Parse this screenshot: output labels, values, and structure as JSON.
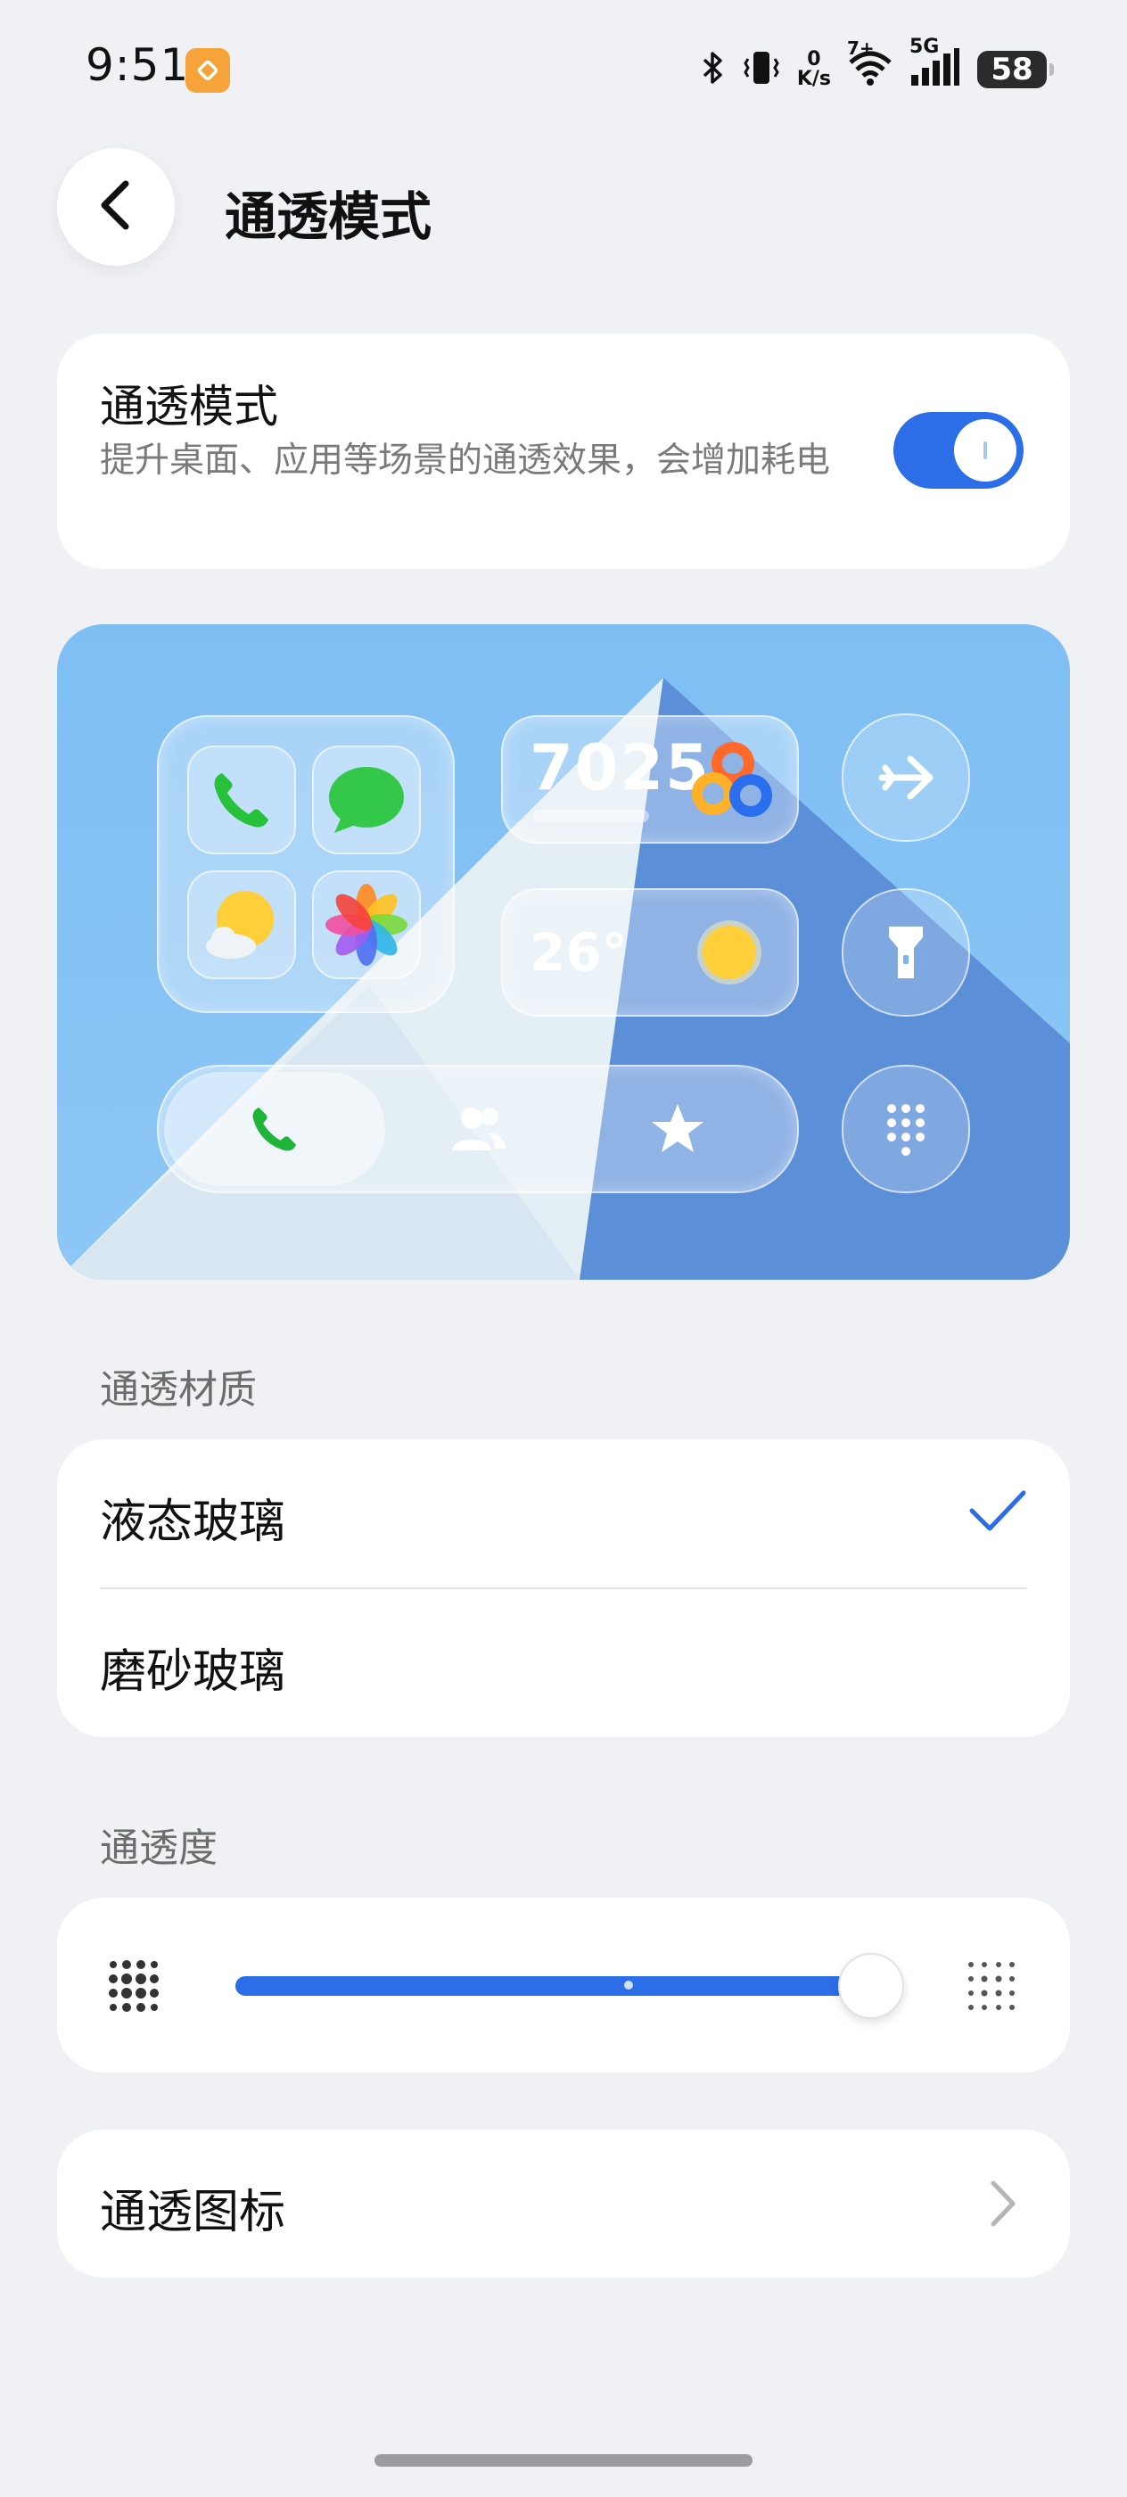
{
  "status_bar": {
    "time": "9:51",
    "net_speed_value": "0",
    "net_speed_unit": "K/s",
    "wifi_badge": "7+",
    "signal_label": "5G",
    "battery_level": "58"
  },
  "header": {
    "title": "通透模式"
  },
  "mode_toggle": {
    "title": "通透模式",
    "description": "提升桌面、应用等场景的通透效果，会增加耗电",
    "enabled": true,
    "accent_color": "#2b6ee8"
  },
  "preview": {
    "steps": "7025",
    "temperature": "26°",
    "icons": [
      "phone-icon",
      "message-icon",
      "weather-icon",
      "photos-icon",
      "health-rings-icon",
      "sun-icon",
      "airplane-icon",
      "flashlight-icon",
      "dialpad-icon",
      "contacts-icon",
      "star-icon"
    ]
  },
  "material": {
    "section_label": "通透材质",
    "options": [
      {
        "label": "液态玻璃",
        "selected": true
      },
      {
        "label": "磨砂玻璃",
        "selected": false
      }
    ]
  },
  "transparency": {
    "section_label": "通透度",
    "level": 1.0
  },
  "transparent_icons": {
    "label": "通透图标"
  }
}
